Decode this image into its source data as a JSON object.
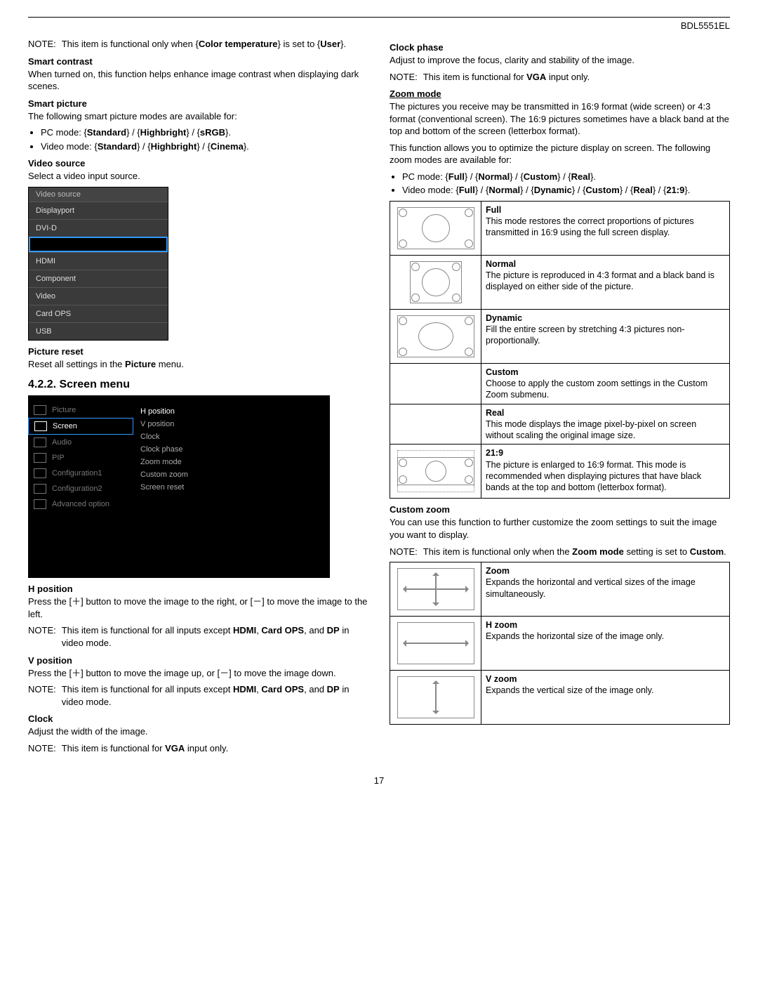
{
  "model": "BDL5551EL",
  "page_number": "17",
  "left": {
    "note_intro_label": "NOTE:",
    "note_intro": "This item is functional only when {Color temperature} is set to {User}.",
    "smart_contrast_h": "Smart contrast",
    "smart_contrast_p": "When turned on, this function helps enhance image contrast when displaying dark scenes.",
    "smart_picture_h": "Smart picture",
    "smart_picture_p": "The following smart picture modes are available for:",
    "sp_li1": "PC mode: {Standard} / {Highbright} / {sRGB}.",
    "sp_li2": "Video mode: {Standard} / {Highbright} / {Cinema}.",
    "video_source_h": "Video source",
    "video_source_p": "Select a video input source.",
    "vs_menu_hdr": "Video source",
    "vs_items": [
      "Displayport",
      "DVI-D",
      "",
      "HDMI",
      "Component",
      "Video",
      "Card OPS",
      "USB"
    ],
    "picture_reset_h": "Picture reset",
    "picture_reset_p": "Reset all settings in the Picture menu.",
    "screen_menu_h": "4.2.2.  Screen menu",
    "sm_left": [
      "Picture",
      "Screen",
      "Audio",
      "PIP",
      "Configuration1",
      "Configuration2",
      "Advanced option"
    ],
    "sm_right": [
      "H position",
      "V position",
      "Clock",
      "Clock phase",
      "Zoom mode",
      "Custom zoom",
      "Screen reset"
    ],
    "hpos_h": "H position",
    "hpos_p": "Press the [＋] button to move the image to the right, or [－] to move the image to the left.",
    "hpos_note_l": "NOTE:",
    "hpos_note": "This item is functional for all inputs except HDMI, Card OPS, and DP in video mode.",
    "vpos_h": "V position",
    "vpos_p": "Press the [＋] button to move the image up, or [－] to move the image down.",
    "vpos_note_l": "NOTE:",
    "vpos_note": "This item is functional for all inputs except HDMI, Card OPS, and DP in video mode.",
    "clock_h": "Clock",
    "clock_p": "Adjust the width of the image.",
    "clock_note_l": "NOTE:",
    "clock_note": "This item is functional for VGA input only."
  },
  "right": {
    "clock_phase_h": "Clock phase",
    "clock_phase_p": "Adjust to improve the focus, clarity and stability of the image.",
    "cp_note_l": "NOTE:",
    "cp_note": "This item is functional for VGA input only.",
    "zoom_mode_h": "Zoom mode",
    "zm_p1": "The pictures you receive may be transmitted in 16:9 format (wide screen) or 4:3 format (conventional screen). The 16:9 pictures sometimes have a black band at the top and bottom of the screen (letterbox format).",
    "zm_p2": "This function allows you to optimize the picture display on screen. The following zoom modes are available for:",
    "zm_li1": "PC mode: {Full} / {Normal} / {Custom} / {Real}.",
    "zm_li2": "Video mode: {Full} / {Normal} / {Dynamic} / {Custom} / {Real} / {21:9}.",
    "ztable": [
      {
        "name": "Full",
        "desc": "This mode restores the correct proportions of pictures transmitted in 16:9 using the full screen display."
      },
      {
        "name": "Normal",
        "desc": "The picture is reproduced in 4:3 format and a black band is displayed on either side of the picture."
      },
      {
        "name": "Dynamic",
        "desc": "Fill the entire screen by stretching 4:3 pictures non-proportionally."
      },
      {
        "name": "Custom",
        "desc": "Choose to apply the custom zoom settings in the Custom Zoom submenu."
      },
      {
        "name": "Real",
        "desc": "This mode displays the image pixel-by-pixel on screen without scaling the original image size."
      },
      {
        "name": "21:9",
        "desc": "The picture is enlarged to 16:9 format. This mode is recommended when displaying pictures that have black bands at the top and bottom (letterbox format)."
      }
    ],
    "custom_zoom_h": "Custom zoom",
    "cz_p": "You can use this function to further customize the zoom settings to suit the image you want to display.",
    "cz_note_l": "NOTE:",
    "cz_note": "This item is functional only when the Zoom mode setting is set to Custom.",
    "cztable": [
      {
        "name": "Zoom",
        "desc": "Expands the horizontal and vertical sizes of the image simultaneously."
      },
      {
        "name": "H zoom",
        "desc": "Expands the horizontal size of the image only."
      },
      {
        "name": "V zoom",
        "desc": "Expands the vertical size of the image only."
      }
    ]
  }
}
